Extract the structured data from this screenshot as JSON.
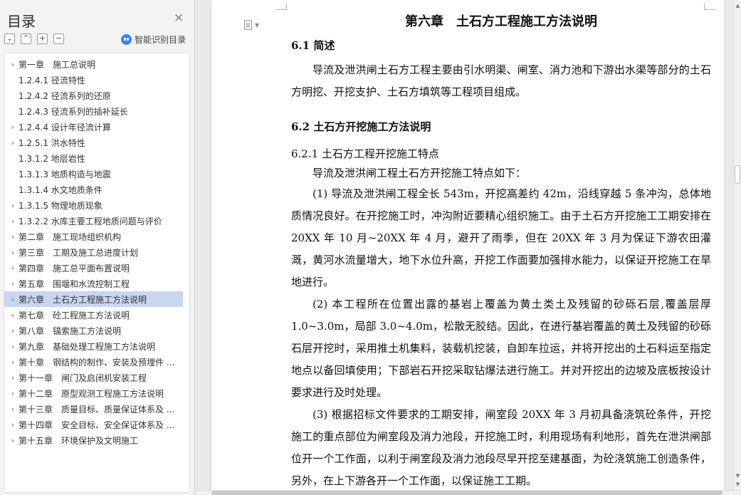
{
  "nav": {
    "title": "目录",
    "close_glyph": "×",
    "tools": [
      "⌄",
      "⌃",
      "+",
      "−"
    ],
    "smart_toc_label": "智能识别目录",
    "items": [
      {
        "text": "第一章　施工总说明",
        "caret": "›",
        "active": false
      },
      {
        "text": "1.2.4.1 径流特性",
        "caret": "",
        "active": false
      },
      {
        "text": "1.2.4.2  径流系列的还原",
        "caret": "",
        "active": false
      },
      {
        "text": "1.2.4.3  径流系列的插补延长",
        "caret": "",
        "active": false
      },
      {
        "text": "1.2.4.4 设计年径流计算",
        "caret": "›",
        "active": false
      },
      {
        "text": "1.2.5.1  洪水特性",
        "caret": "›",
        "active": false
      },
      {
        "text": "1.3.1.2  地层岩性",
        "caret": "",
        "active": false
      },
      {
        "text": "1.3.1.3  地质构造与地震",
        "caret": "",
        "active": false
      },
      {
        "text": "1.3.1.4  水文地质条件",
        "caret": "",
        "active": false
      },
      {
        "text": "1.3.1.5  物理地质现象",
        "caret": "›",
        "active": false
      },
      {
        "text": "1.3.2.2 水库主要工程地质问题与评价",
        "caret": "›",
        "active": false
      },
      {
        "text": "第二章　施工现场组织机构",
        "caret": "›",
        "active": false
      },
      {
        "text": "第三章　工期及施工总进度计划",
        "caret": "›",
        "active": false
      },
      {
        "text": "第四章　施工总平面布置说明",
        "caret": "›",
        "active": false
      },
      {
        "text": "第五章　围堰和水流控制工程",
        "caret": "›",
        "active": false
      },
      {
        "text": "第六章　土石方工程施工方法说明",
        "caret": "›",
        "active": true
      },
      {
        "text": "第七章　砼工程施工方法说明",
        "caret": "›",
        "active": false
      },
      {
        "text": "第八章　锚索施工方法说明",
        "caret": "›",
        "active": false
      },
      {
        "text": "第九章　基础处理工程施工方法说明",
        "caret": "›",
        "active": false
      },
      {
        "text": "第十章　钢结构的制作、安装及预埋件 ...",
        "caret": "›",
        "active": false
      },
      {
        "text": "第十一章　闸门及启闭机安装工程",
        "caret": "›",
        "active": false
      },
      {
        "text": "第十二章　原型观测工程施工方法说明",
        "caret": "›",
        "active": false
      },
      {
        "text": "第十三章　质量目标、质量保证体系及 ...",
        "caret": "›",
        "active": false
      },
      {
        "text": "第十四章　安全目标、安全保证体系及 ...",
        "caret": "›",
        "active": false
      },
      {
        "text": "第十五章　环境保护及文明施工",
        "caret": "›",
        "active": false
      }
    ]
  },
  "document": {
    "chapter_title": "第六章　土石方工程施工方法说明",
    "section_6_1": "6.1  简述",
    "intro_para": "导流及泄洪闸土石方工程主要由引水明渠、闸室、消力池和下游出水渠等部分的土石方明挖、开挖支护、土石方填筑等工程项目组成。",
    "section_6_2": "6.2  土石方开挖施工方法说明",
    "section_6_2_1": "6.2.1  土石方工程开挖施工特点",
    "lead_para": "导流及泄洪闸工程土石方开挖施工特点如下：",
    "para_1": "(1) 导流及泄洪闸工程全长 543m，开挖高差约 42m，沿线穿越 5 条冲沟，总体地质情况良好。在开挖施工时，冲沟附近要精心组织施工。由于土石方开挖施工工期安排在 20XX 年 10 月~20XX 年 4 月，避开了雨季，但在 20XX 年 3 月为保证下游农田灌溉，黄河水流量增大，地下水位升高，开挖工作面要加强排水能力，以保证开挖施工在旱地进行。",
    "para_2": "(2) 本工程所在位置出露的基岩上覆盖为黄土类土及残留的砂砾石层,覆盖层厚 1.0~3.0m，局部 3.0~4.0m，松散无胶结。因此，在进行基岩覆盖的黄土及残留的砂砾石层开挖时，采用推土机集料，装载机挖装，自卸车拉运，并将开挖出的土石料运至指定地点以备回填使用；下部岩石开挖采取钻爆法进行施工。并对开挖出的边坡及底板按设计要求进行及时处理。",
    "para_3": "(3) 根据招标文件要求的工期安排，闸室段 20XX 年 3 月初具备浇筑砼条件，开挖施工的重点部位为闸室段及消力池段，开挖施工时，利用现场有利地形，首先在泄洪闸部位开一个工作面，以利于闸室段及消力池段尽早开挖至建基面，为砼浇筑施工创造条件，另外，在上下游各开一个工作面，以保证施工工期。"
  },
  "scrollbar": {
    "up": "▲",
    "down": "▼"
  },
  "colors": {
    "active_item": "#c8d6f0",
    "accent": "#3b82f6"
  }
}
